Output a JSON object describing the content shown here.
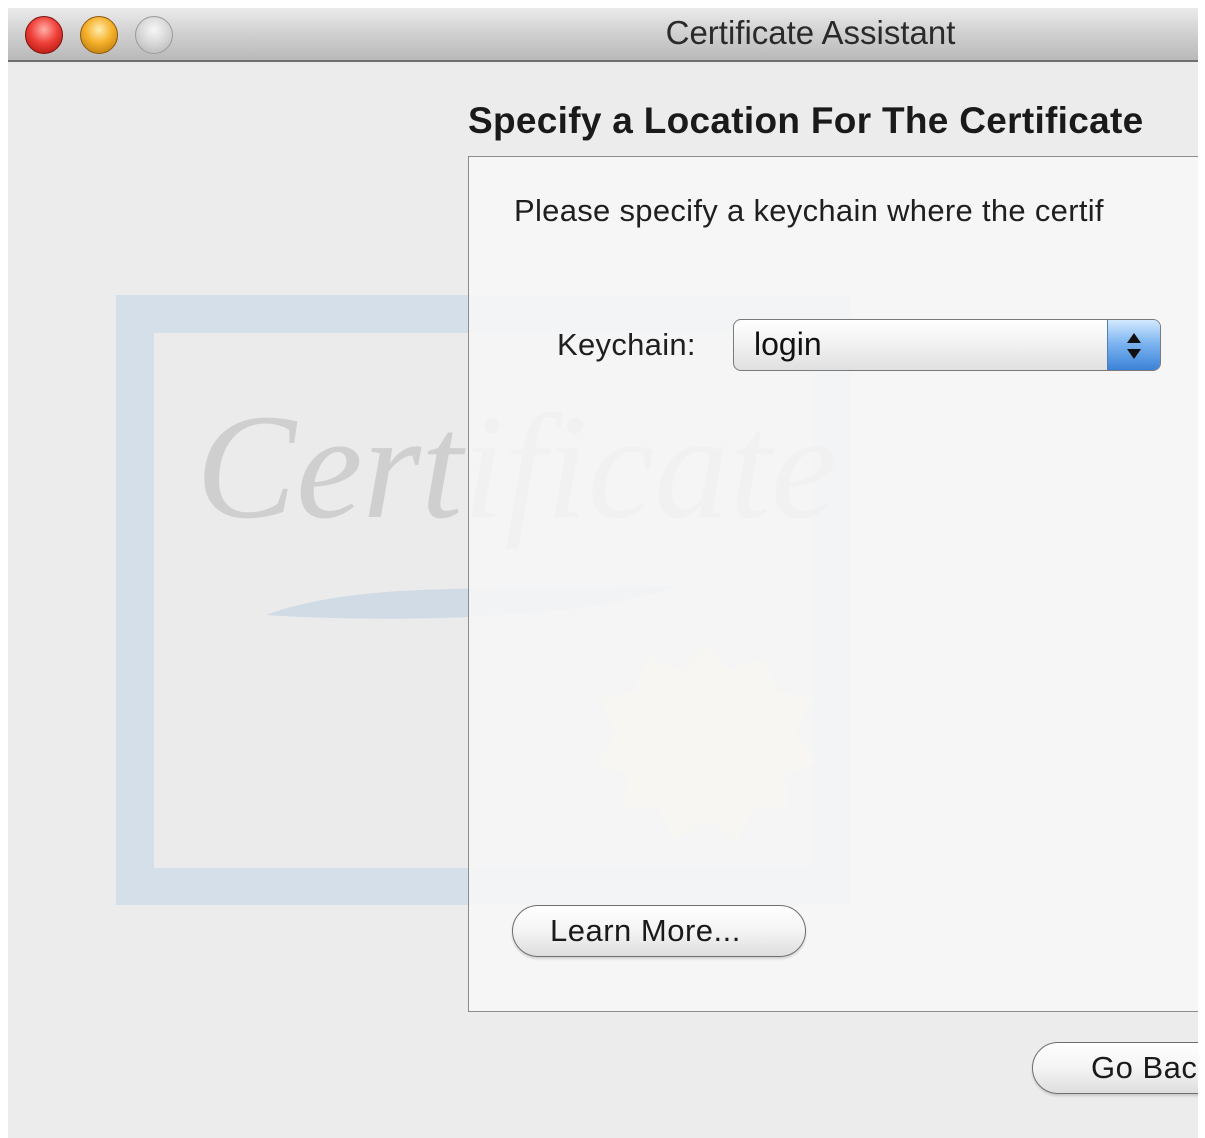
{
  "window": {
    "title": "Certificate Assistant"
  },
  "watermark": {
    "text": "Certificate"
  },
  "page": {
    "section_title": "Specify a Location For The Certificate",
    "instructions": "Please specify a keychain where the certif",
    "keychain_label": "Keychain:",
    "keychain_value": "login",
    "learn_more_label": "Learn More...",
    "go_back_label": "Go Bac"
  },
  "icons": {
    "close": "close-icon",
    "minimize": "minimize-icon",
    "zoom": "zoom-icon",
    "popup_arrows": "up-down-arrows-icon"
  }
}
